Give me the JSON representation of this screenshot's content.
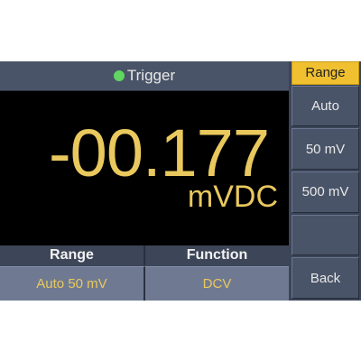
{
  "header": {
    "status_label": "Trigger",
    "status_color": "#5fd65f"
  },
  "reading": {
    "value": "-00.177",
    "unit": "mVDC",
    "color": "#e9c85e"
  },
  "status_table": {
    "headers": [
      "Range",
      "Function"
    ],
    "values": [
      "Auto 50 mV",
      "DCV"
    ]
  },
  "softkeys": {
    "menu_title": "Range",
    "items": [
      "Auto",
      "50 mV",
      "500 mV",
      "",
      "Back"
    ]
  }
}
